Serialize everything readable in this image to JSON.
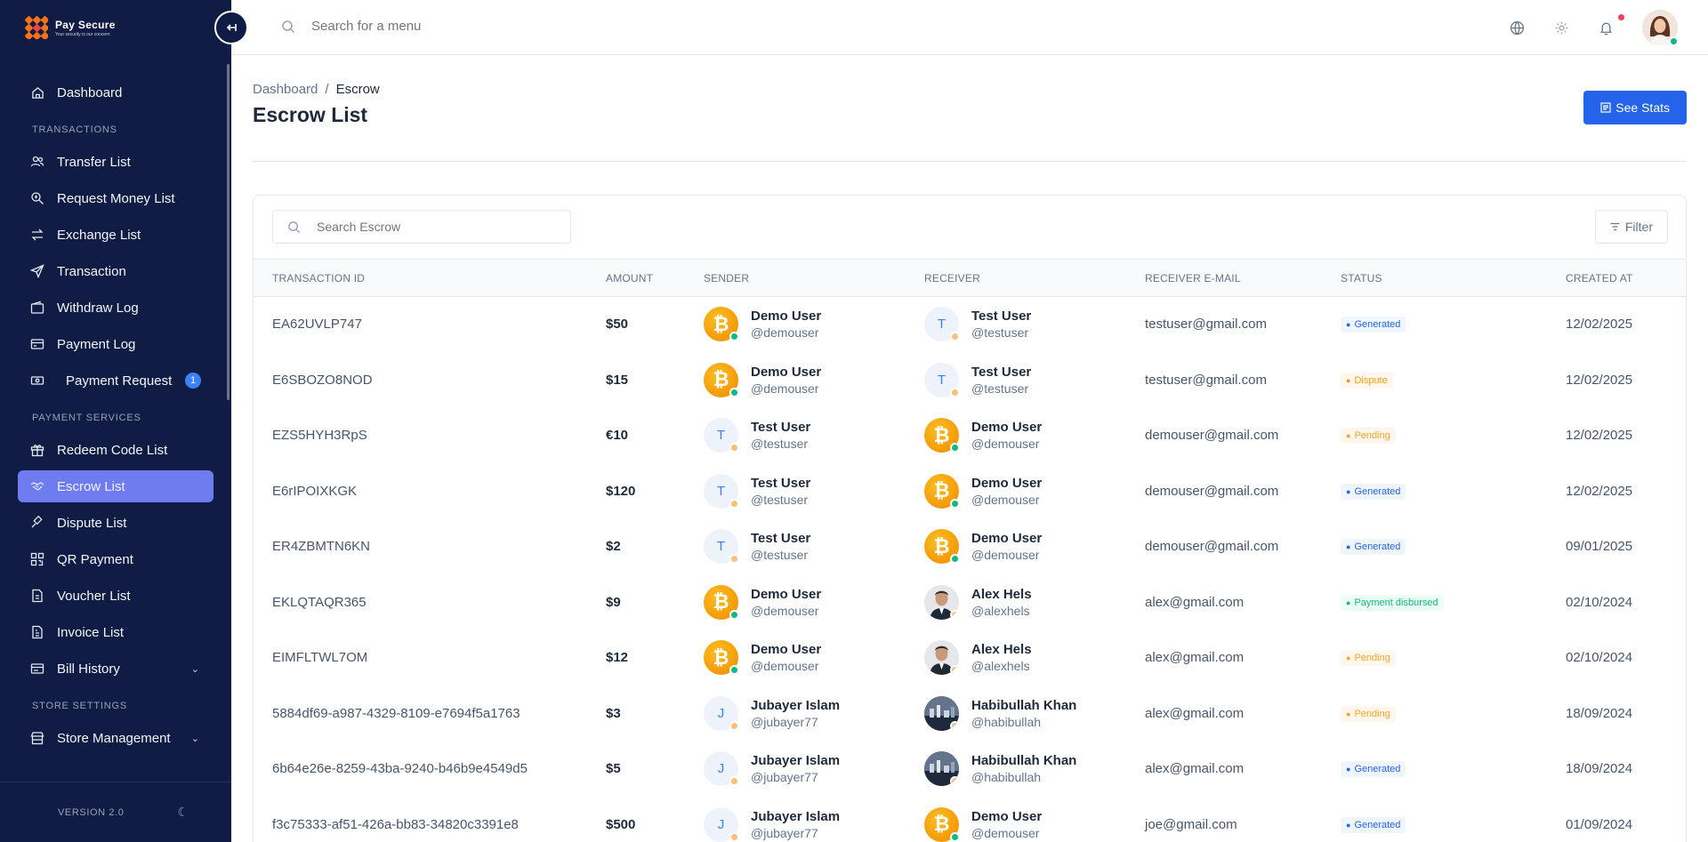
{
  "brand": {
    "name": "Pay Secure",
    "tagline": "Your security is our concern"
  },
  "sidebar": {
    "items": [
      {
        "label": "Dashboard",
        "icon": "home-icon"
      }
    ],
    "section_transactions": "TRANSACTIONS",
    "transactions": [
      {
        "label": "Transfer List",
        "icon": "users-icon"
      },
      {
        "label": "Request Money List",
        "icon": "search-money-icon"
      },
      {
        "label": "Exchange List",
        "icon": "exchange-icon"
      },
      {
        "label": "Transaction",
        "icon": "send-icon"
      },
      {
        "label": "Withdraw Log",
        "icon": "wallet-icon"
      },
      {
        "label": "Payment Log",
        "icon": "card-icon"
      },
      {
        "label": "Payment Request",
        "icon": "money-icon",
        "badge": "1"
      }
    ],
    "section_payment": "PAYMENT SERVICES",
    "payment": [
      {
        "label": "Redeem Code List",
        "icon": "gift-icon"
      },
      {
        "label": "Escrow List",
        "icon": "handshake-icon",
        "active": true
      },
      {
        "label": "Dispute List",
        "icon": "gavel-icon"
      },
      {
        "label": "QR Payment",
        "icon": "qr-icon"
      },
      {
        "label": "Voucher List",
        "icon": "voucher-icon"
      },
      {
        "label": "Invoice List",
        "icon": "invoice-icon"
      },
      {
        "label": "Bill History",
        "icon": "bill-icon"
      }
    ],
    "section_store": "STORE SETTINGS",
    "store": [
      {
        "label": "Store Management",
        "icon": "store-icon"
      }
    ],
    "version": "VERSION 2.0"
  },
  "topbar": {
    "search_placeholder": "Search for a menu"
  },
  "page": {
    "breadcrumb_root": "Dashboard",
    "breadcrumb_sep": "/",
    "breadcrumb_current": "Escrow",
    "title": "Escrow List",
    "stats_button": "See Stats",
    "search_placeholder": "Search Escrow",
    "filter_button": "Filter"
  },
  "table": {
    "headers": [
      "TRANSACTION ID",
      "AMOUNT",
      "SENDER",
      "RECEIVER",
      "RECEIVER E-MAIL",
      "STATUS",
      "CREATED AT"
    ],
    "rows": [
      {
        "id": "EA62UVLP747",
        "amount": "$50",
        "sender": {
          "name": "Demo User",
          "handle": "@demouser",
          "avatar": "btc"
        },
        "receiver": {
          "name": "Test User",
          "handle": "@testuser",
          "avatar": "letter",
          "initial": "T"
        },
        "email": "testuser@gmail.com",
        "status": "Generated",
        "status_type": "generated",
        "date": "12/02/2025"
      },
      {
        "id": "E6SBOZO8NOD",
        "amount": "$15",
        "sender": {
          "name": "Demo User",
          "handle": "@demouser",
          "avatar": "btc"
        },
        "receiver": {
          "name": "Test User",
          "handle": "@testuser",
          "avatar": "letter",
          "initial": "T"
        },
        "email": "testuser@gmail.com",
        "status": "Dispute",
        "status_type": "dispute",
        "date": "12/02/2025"
      },
      {
        "id": "EZS5HYH3RpS",
        "amount": "€10",
        "sender": {
          "name": "Test User",
          "handle": "@testuser",
          "avatar": "letter",
          "initial": "T"
        },
        "receiver": {
          "name": "Demo User",
          "handle": "@demouser",
          "avatar": "btc"
        },
        "email": "demouser@gmail.com",
        "status": "Pending",
        "status_type": "pending",
        "date": "12/02/2025"
      },
      {
        "id": "E6rIPOIXKGK",
        "amount": "$120",
        "sender": {
          "name": "Test User",
          "handle": "@testuser",
          "avatar": "letter",
          "initial": "T"
        },
        "receiver": {
          "name": "Demo User",
          "handle": "@demouser",
          "avatar": "btc"
        },
        "email": "demouser@gmail.com",
        "status": "Generated",
        "status_type": "generated",
        "date": "12/02/2025"
      },
      {
        "id": "ER4ZBMTN6KN",
        "amount": "$2",
        "sender": {
          "name": "Test User",
          "handle": "@testuser",
          "avatar": "letter",
          "initial": "T"
        },
        "receiver": {
          "name": "Demo User",
          "handle": "@demouser",
          "avatar": "btc"
        },
        "email": "demouser@gmail.com",
        "status": "Generated",
        "status_type": "generated",
        "date": "09/01/2025"
      },
      {
        "id": "EKLQTAQR365",
        "amount": "$9",
        "sender": {
          "name": "Demo User",
          "handle": "@demouser",
          "avatar": "btc"
        },
        "receiver": {
          "name": "Alex Hels",
          "handle": "@alexhels",
          "avatar": "photo"
        },
        "email": "alex@gmail.com",
        "status": "Payment disbursed",
        "status_type": "disbursed",
        "date": "02/10/2024"
      },
      {
        "id": "EIMFLTWL7OM",
        "amount": "$12",
        "sender": {
          "name": "Demo User",
          "handle": "@demouser",
          "avatar": "btc"
        },
        "receiver": {
          "name": "Alex Hels",
          "handle": "@alexhels",
          "avatar": "photo"
        },
        "email": "alex@gmail.com",
        "status": "Pending",
        "status_type": "pending",
        "date": "02/10/2024"
      },
      {
        "id": "5884df69-a987-4329-8109-e7694f5a1763",
        "amount": "$3",
        "sender": {
          "name": "Jubayer Islam",
          "handle": "@jubayer77",
          "avatar": "letter",
          "initial": "J"
        },
        "receiver": {
          "name": "Habibullah Khan",
          "handle": "@habibullah",
          "avatar": "photo-city"
        },
        "email": "alex@gmail.com",
        "status": "Pending",
        "status_type": "pending",
        "date": "18/09/2024"
      },
      {
        "id": "6b64e26e-8259-43ba-9240-b46b9e4549d5",
        "amount": "$5",
        "sender": {
          "name": "Jubayer Islam",
          "handle": "@jubayer77",
          "avatar": "letter",
          "initial": "J"
        },
        "receiver": {
          "name": "Habibullah Khan",
          "handle": "@habibullah",
          "avatar": "photo-city"
        },
        "email": "alex@gmail.com",
        "status": "Generated",
        "status_type": "generated",
        "date": "18/09/2024"
      },
      {
        "id": "f3c75333-af51-426a-bb83-34820c3391e8",
        "amount": "$500",
        "sender": {
          "name": "Jubayer Islam",
          "handle": "@jubayer77",
          "avatar": "letter",
          "initial": "J"
        },
        "receiver": {
          "name": "Demo User",
          "handle": "@demouser",
          "avatar": "btc"
        },
        "email": "joe@gmail.com",
        "status": "Generated",
        "status_type": "generated",
        "date": "01/09/2024"
      }
    ]
  },
  "colors": {
    "sidebar_bg": "#111c44",
    "active": "#6f7cf0",
    "primary": "#2563eb"
  }
}
